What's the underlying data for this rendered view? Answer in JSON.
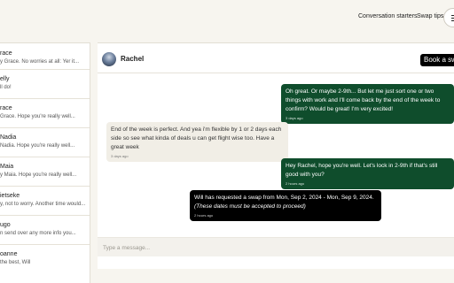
{
  "topbar": {
    "conversation_starters": "Conversation starters",
    "swap_tips": "Swap tips",
    "menu_icon": "hamburger-menu-icon"
  },
  "sidebar": {
    "items": [
      {
        "name": "race",
        "preview": "y Grace. No worries at all: Yer it..."
      },
      {
        "name": "elly",
        "preview": "ll do!"
      },
      {
        "name": "race",
        "preview": "Grace. Hope you're really well..."
      },
      {
        "name": "Nadia",
        "preview": "Nadia. Hope you're really well..."
      },
      {
        "name": "Maia",
        "preview": "y Maia. Hope you're really well..."
      },
      {
        "name": "ietseke",
        "preview": "y, not to worry. Another time would..."
      },
      {
        "name": "ugo",
        "preview": "n send over any more info you..."
      },
      {
        "name": "oanne",
        "preview": "the best, Will"
      }
    ]
  },
  "chat": {
    "name": "Rachel",
    "book_button": "Book a swap",
    "messages": [
      {
        "text": "Oh great. Or maybe 2-9th... But let me just sort one or two things with work and I'll come back by the end of the week to confirm? Would be great! I'm very excited!",
        "time": "3 days ago"
      },
      {
        "text": "End of the week is perfect. And yea i'm flexible by 1 or 2 days each side so see what kinda of deals u can get flight wise too. Have a great week",
        "time": "3 days ago"
      },
      {
        "text": "Hey Rachel, hope you're well. Let's lock in 2-9th if that's still good with you?",
        "time": "2 hours ago"
      },
      {
        "text": "Will has requested a swap from Mon, Sep 2, 2024 - Mon, Sep 9, 2024.",
        "note": "(These dates must be accepted to proceed)",
        "time": "2 hours ago"
      }
    ],
    "composer_placeholder": "Type a message..."
  },
  "colors": {
    "outgoing_bubble": "#0f4d2c",
    "incoming_bubble": "#f1eee6",
    "system_bubble": "#000000",
    "background": "#f7f5ef"
  }
}
